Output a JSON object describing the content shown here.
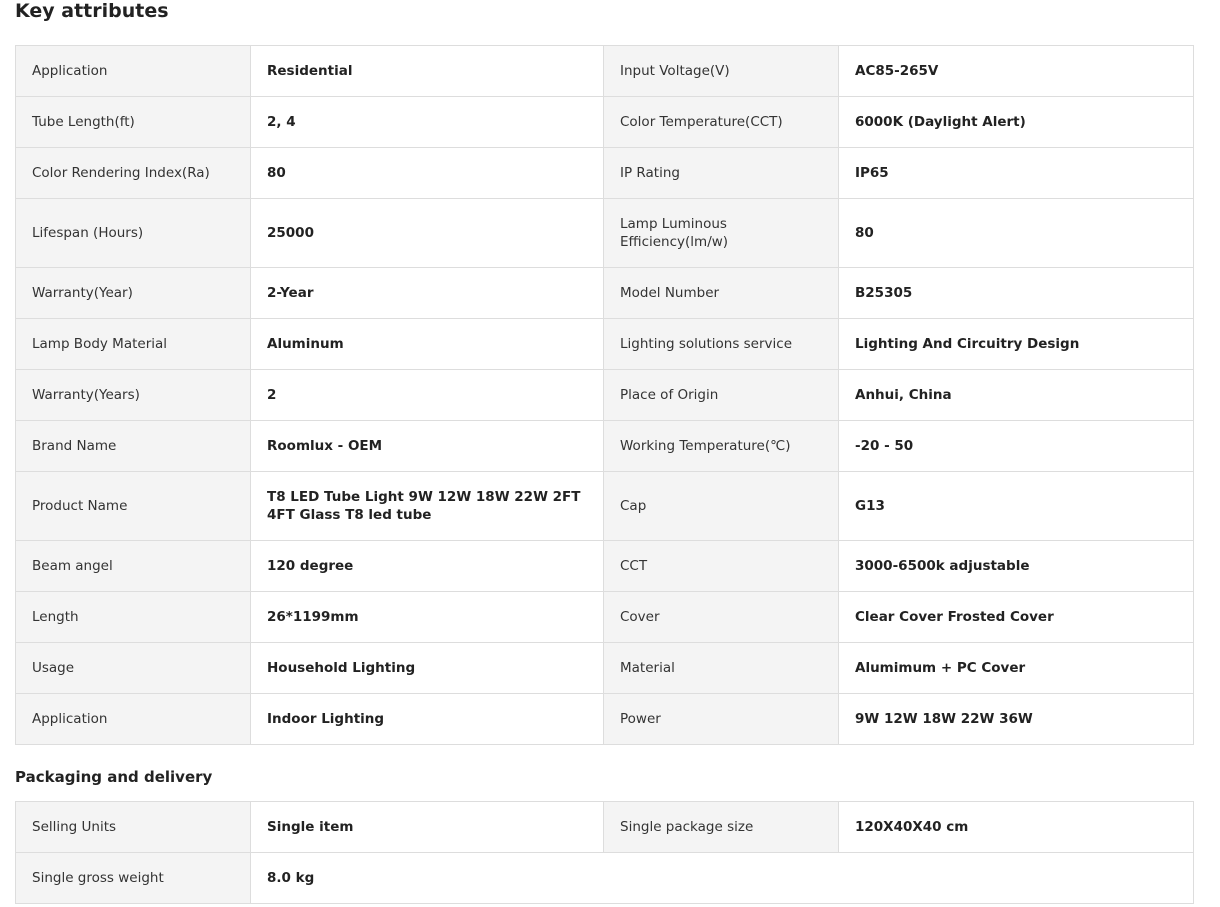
{
  "key_attributes": {
    "title": "Key attributes",
    "rows": [
      {
        "left_name": "Application",
        "left_value": "Residential",
        "right_name": "Input Voltage(V)",
        "right_value": "AC85-265V"
      },
      {
        "left_name": "Tube Length(ft)",
        "left_value": "2, 4",
        "right_name": "Color Temperature(CCT)",
        "right_value": "6000K (Daylight Alert)"
      },
      {
        "left_name": "Color Rendering Index(Ra)",
        "left_value": "80",
        "right_name": "IP Rating",
        "right_value": "IP65"
      },
      {
        "left_name": "Lifespan (Hours)",
        "left_value": "25000",
        "right_name": "Lamp Luminous Efficiency(lm/w)",
        "right_value": "80"
      },
      {
        "left_name": "Warranty(Year)",
        "left_value": "2-Year",
        "right_name": "Model Number",
        "right_value": "B25305"
      },
      {
        "left_name": "Lamp Body Material",
        "left_value": "Aluminum",
        "right_name": "Lighting solutions service",
        "right_value": "Lighting And Circuitry Design"
      },
      {
        "left_name": "Warranty(Years)",
        "left_value": "2",
        "right_name": "Place of Origin",
        "right_value": "Anhui, China"
      },
      {
        "left_name": "Brand Name",
        "left_value": "Roomlux - OEM",
        "right_name": "Working Temperature(℃)",
        "right_value": "-20 - 50"
      },
      {
        "left_name": "Product Name",
        "left_value": "T8 LED Tube Light 9W 12W 18W 22W 2FT 4FT Glass T8 led tube",
        "right_name": "Cap",
        "right_value": "G13"
      },
      {
        "left_name": "Beam angel",
        "left_value": "120 degree",
        "right_name": "CCT",
        "right_value": "3000-6500k adjustable"
      },
      {
        "left_name": "Length",
        "left_value": "26*1199mm",
        "right_name": "Cover",
        "right_value": "Clear Cover Frosted Cover"
      },
      {
        "left_name": "Usage",
        "left_value": "Household Lighting",
        "right_name": "Material",
        "right_value": "Alumimum + PC Cover"
      },
      {
        "left_name": "Application",
        "left_value": "Indoor Lighting",
        "right_name": "Power",
        "right_value": "9W 12W 18W 22W 36W"
      }
    ]
  },
  "packaging": {
    "title": "Packaging and delivery",
    "rows": [
      {
        "left_name": "Selling Units",
        "left_value": "Single item",
        "right_name": "Single package size",
        "right_value": "120X40X40 cm"
      },
      {
        "left_name": "Single gross weight",
        "left_value": "8.0 kg",
        "right_name": "",
        "right_value": ""
      }
    ]
  }
}
